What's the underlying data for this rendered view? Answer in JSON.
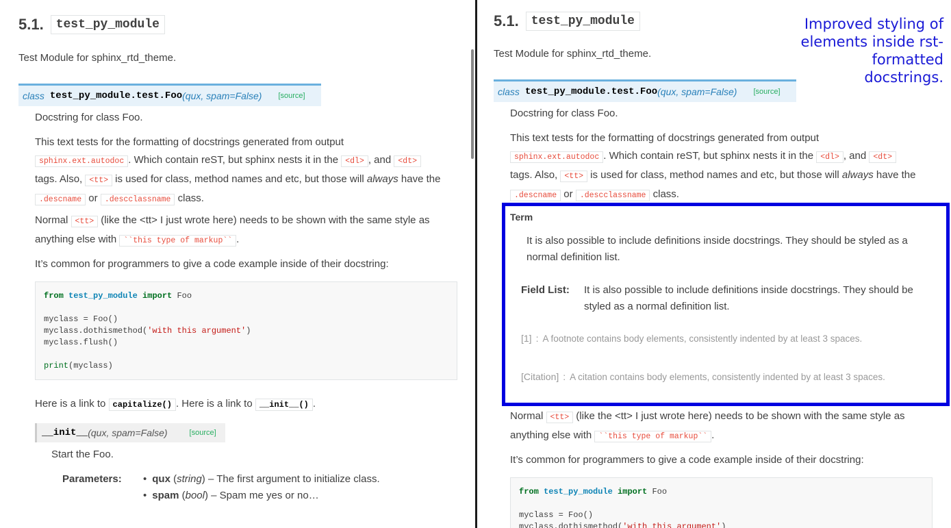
{
  "left": {
    "heading": {
      "number": "5.1.",
      "code": "test_py_module"
    },
    "intro": "Test Module for sphinx_rtd_theme.",
    "signature": {
      "keyword": "class",
      "name": "test_py_module.test.Foo",
      "params": "(qux, spam=False)",
      "source": "[source]"
    },
    "docstring": "Docstring for class Foo.",
    "para1": {
      "t1": "This text tests for the formatting of docstrings generated from output",
      "c1": "sphinx.ext.autodoc",
      "t2": ". Which contain reST, but sphinx nests it in the",
      "c2": "<dl>",
      "t3": ", and",
      "c3": "<dt>",
      "t4": "tags. Also,",
      "c4": "<tt>",
      "t5": "is used for class, method names and etc, but those will",
      "em": "always",
      "t6": "have the",
      "c5": ".descname",
      "t7": "or",
      "c6": ".descclassname",
      "t8": "class."
    },
    "para2": {
      "t1": "Normal",
      "c1": "<tt>",
      "t2": "(like the <tt> I just wrote here) needs to be shown with the same style as",
      "t3": "anything else with",
      "c2": "``this type of markup``",
      "t4": "."
    },
    "para3": "It’s common for programmers to give a code example inside of their docstring:",
    "code": {
      "l1a": "from",
      "l1b": "test_py_module",
      "l1c": "import",
      "l1d": "Foo",
      "l2": "myclass = Foo()",
      "l3a": "myclass.dothismethod(",
      "l3b": "'with this argument'",
      "l3c": ")",
      "l4": "myclass.flush()",
      "l5a": "print",
      "l5b": "(myclass)"
    },
    "links": {
      "t1": "Here is a link to",
      "c1": "capitalize()",
      "t2": ". Here is a link to",
      "c2": "__init__()",
      "t3": "."
    },
    "init_sig": {
      "name": "__init__",
      "params": "(qux, spam=False)",
      "source": "[source]"
    },
    "init_doc": "Start the Foo.",
    "parameters": {
      "label": "Parameters:",
      "items": [
        {
          "name": "qux",
          "type": "string",
          "desc": "– The first argument to initialize class."
        },
        {
          "name": "spam",
          "type": "bool",
          "desc": "– Spam me yes or no…"
        }
      ]
    }
  },
  "right": {
    "heading": {
      "number": "5.1.",
      "code": "test_py_module"
    },
    "intro": "Test Module for sphinx_rtd_theme.",
    "signature": {
      "keyword": "class",
      "name": "test_py_module.test.Foo",
      "params": "(qux, spam=False)",
      "source": "[source]"
    },
    "docstring": "Docstring for class Foo.",
    "term": "Term",
    "term_def": "It is also possible to include definitions inside docstrings. They should be styled as a normal definition list.",
    "field_label": "Field List:",
    "field_def": "It is also possible to include definitions inside docstrings. They should be styled as a normal definition list.",
    "footnote": {
      "label": "[1]",
      "sep": ":",
      "text": "A footnote contains body elements, consistently indented by at least 3 spaces."
    },
    "citation": {
      "label": "[Citation]",
      "sep": ":",
      "text": "A citation contains body elements, consistently indented by at least 3 spaces."
    },
    "code": {
      "l1a": "from",
      "l1b": "test_py_module",
      "l1c": "import",
      "l1d": "Foo",
      "l2": "myclass = Foo()",
      "l3a": "myclass.dothismethod(",
      "l3b": "'with this argument'",
      "l3c": ")"
    }
  },
  "annotation": "Improved styling of elements inside rst-formatted docstrings.",
  "colors": {
    "accent": "#2980b9",
    "highlight_border": "#0000e0",
    "annotation_text": "#1a1ad6"
  }
}
